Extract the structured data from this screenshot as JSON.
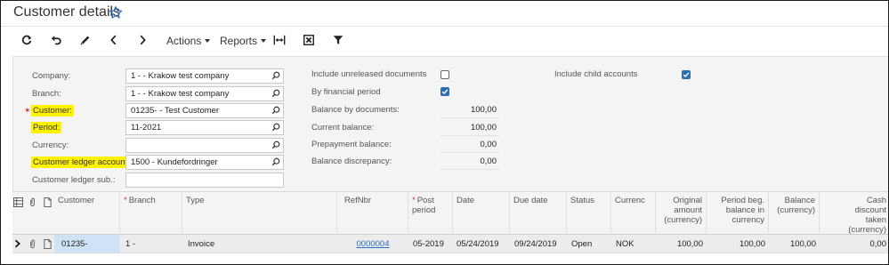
{
  "header": {
    "title": "Customer details"
  },
  "toolbar": {
    "actions_label": "Actions",
    "reports_label": "Reports"
  },
  "form": {
    "company_label": "Company:",
    "company_value": "1    - - Krakow test company",
    "branch_label": "Branch:",
    "branch_value": "1    - - Krakow test company",
    "customer_label": "Customer:",
    "customer_value": "01235- - Test Customer",
    "period_label": "Period:",
    "period_value": "11-2021",
    "currency_label": "Currency:",
    "currency_value": "",
    "ledger_account_label": "Customer ledger account:",
    "ledger_account_value": "1500 - Kundefordringer",
    "ledger_sub_label": "Customer ledger sub.:",
    "ledger_sub_value": "",
    "include_unreleased_label": "Include unreleased documents",
    "include_unreleased_checked": false,
    "by_financial_period_label": "By financial period",
    "by_financial_period_checked": true,
    "balance_by_docs_label": "Balance by documents:",
    "balance_by_docs_value": "100,00",
    "current_balance_label": "Current balance:",
    "current_balance_value": "100,00",
    "prepayment_balance_label": "Prepayment balance:",
    "prepayment_balance_value": "0,00",
    "balance_discrepancy_label": "Balance discrepancy:",
    "balance_discrepancy_value": "0,00",
    "include_child_label": "Include child accounts",
    "include_child_checked": true
  },
  "grid": {
    "columns": {
      "customer": "Customer",
      "branch": "Branch",
      "type": "Type",
      "refnbr": "RefNbr",
      "post_period_1": "Post",
      "post_period_2": "period",
      "date": "Date",
      "due_date": "Due date",
      "status": "Status",
      "currency": "Currenc",
      "orig_amount_1": "Original",
      "orig_amount_2": "amount",
      "orig_amount_3": "(currency)",
      "period_beg_1": "Period beg.",
      "period_beg_2": "balance in",
      "period_beg_3": "currency",
      "balance_1": "Balance",
      "balance_2": "(currency)",
      "cash_disc_1": "Cash",
      "cash_disc_2": "discount",
      "cash_disc_3": "taken",
      "cash_disc_4": "(currency)"
    },
    "rows": [
      {
        "customer": "01235-",
        "branch": "1 -",
        "type": "Invoice",
        "refnbr": "0000004",
        "post_period": "05-2019",
        "date": "05/24/2019",
        "due_date": "09/24/2019",
        "status": "Open",
        "currency": "NOK",
        "orig_amount": "100,00",
        "period_beg": "100,00",
        "balance": "100,00",
        "cash_disc": "0,00"
      }
    ]
  },
  "colors": {
    "highlight": "#fff200",
    "accent": "#2f6db5",
    "link": "#2a6ebb",
    "required": "#c0392b"
  },
  "icons": [
    "star-icon",
    "refresh-icon",
    "undo-icon",
    "edit-icon",
    "previous-icon",
    "next-icon",
    "fit-columns-icon",
    "export-excel-icon",
    "filter-icon",
    "search-icon",
    "row-selector-icon",
    "attachment-icon",
    "document-icon"
  ]
}
